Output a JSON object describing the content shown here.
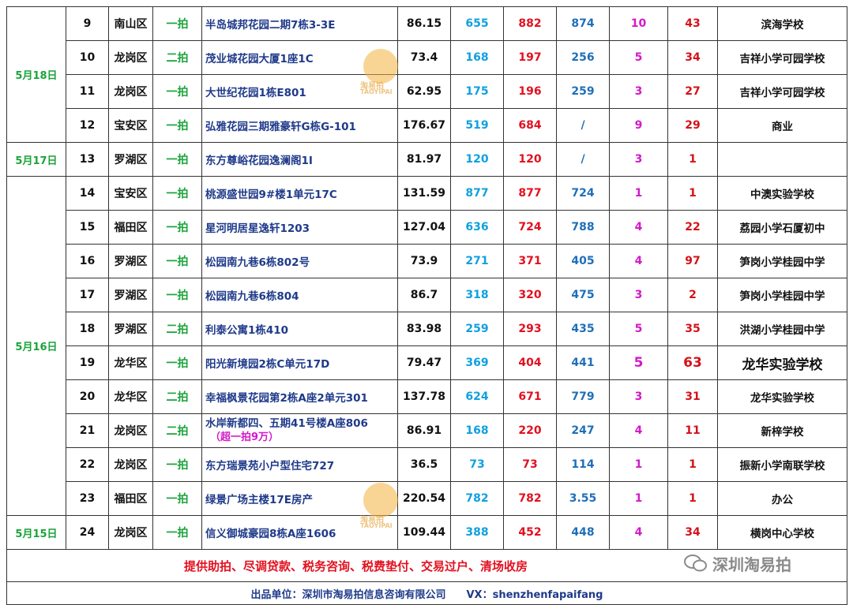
{
  "rows": [
    {
      "date": "",
      "no": "9",
      "district": "南山区",
      "type": "一拍",
      "address": "半岛城邦花园二期7栋3-3E",
      "note": "",
      "area": "86.15",
      "v1": "655",
      "v2": "882",
      "v3": "874",
      "v4": "10",
      "v5": "43",
      "school": "滨海学校"
    },
    {
      "date": "5月18日",
      "no": "10",
      "district": "龙岗区",
      "type": "二拍",
      "address": "茂业城花园大厦1座1C",
      "note": "",
      "area": "73.4",
      "v1": "168",
      "v2": "197",
      "v3": "256",
      "v4": "5",
      "v5": "34",
      "school": "吉祥小学可园学校"
    },
    {
      "date": "",
      "no": "11",
      "district": "龙岗区",
      "type": "一拍",
      "address": "大世纪花园1栋E801",
      "note": "",
      "area": "62.95",
      "v1": "175",
      "v2": "196",
      "v3": "259",
      "v4": "3",
      "v5": "27",
      "school": "吉祥小学可园学校"
    },
    {
      "date": "",
      "no": "12",
      "district": "宝安区",
      "type": "一拍",
      "address": "弘雅花园三期雅豪轩G栋G-101",
      "note": "",
      "area": "176.67",
      "v1": "519",
      "v2": "684",
      "v3": "/",
      "v4": "9",
      "v5": "29",
      "school": "商业"
    },
    {
      "date": "5月17日",
      "no": "13",
      "district": "罗湖区",
      "type": "一拍",
      "address": "东方尊峪花园逸澜阁1I",
      "note": "",
      "area": "81.97",
      "v1": "120",
      "v2": "120",
      "v3": "/",
      "v4": "3",
      "v5": "1",
      "school": ""
    },
    {
      "date": "",
      "no": "14",
      "district": "宝安区",
      "type": "一拍",
      "address": "桃源盛世园9#楼1单元17C",
      "note": "",
      "area": "131.59",
      "v1": "877",
      "v2": "877",
      "v3": "724",
      "v4": "1",
      "v5": "1",
      "school": "中澳实验学校"
    },
    {
      "date": "",
      "no": "15",
      "district": "福田区",
      "type": "一拍",
      "address": "星河明居星逸轩1203",
      "note": "",
      "area": "127.04",
      "v1": "636",
      "v2": "724",
      "v3": "788",
      "v4": "4",
      "v5": "22",
      "school": "荔园小学石厦初中"
    },
    {
      "date": "",
      "no": "16",
      "district": "罗湖区",
      "type": "一拍",
      "address": "松园南九巷6栋802号",
      "note": "",
      "area": "73.9",
      "v1": "271",
      "v2": "371",
      "v3": "405",
      "v4": "4",
      "v5": "97",
      "school": "笋岗小学桂园中学"
    },
    {
      "date": "",
      "no": "17",
      "district": "罗湖区",
      "type": "一拍",
      "address": "松园南九巷6栋804",
      "note": "",
      "area": "86.7",
      "v1": "318",
      "v2": "320",
      "v3": "475",
      "v4": "3",
      "v5": "2",
      "school": "笋岗小学桂园中学"
    },
    {
      "date": "5月16日",
      "no": "18",
      "district": "罗湖区",
      "type": "二拍",
      "address": "利泰公寓1栋410",
      "note": "",
      "area": "83.98",
      "v1": "259",
      "v2": "293",
      "v3": "435",
      "v4": "5",
      "v5": "35",
      "school": "洪湖小学桂园中学"
    },
    {
      "date": "",
      "no": "19",
      "district": "龙华区",
      "type": "一拍",
      "address": "阳光新境园2栋C单元17D",
      "note": "",
      "area": "79.47",
      "v1": "369",
      "v2": "404",
      "v3": "441",
      "v4": "5",
      "v5": "63",
      "school": "龙华实验学校"
    },
    {
      "date": "",
      "no": "20",
      "district": "龙华区",
      "type": "二拍",
      "address": "幸福枫景花园第2栋A座2单元301",
      "note": "",
      "area": "137.78",
      "v1": "624",
      "v2": "671",
      "v3": "779",
      "v4": "3",
      "v5": "31",
      "school": "龙华实验学校"
    },
    {
      "date": "",
      "no": "21",
      "district": "龙岗区",
      "type": "二拍",
      "address": "水岸新都四、五期41号楼A座806",
      "note": "（超一拍9万）",
      "area": "86.91",
      "v1": "168",
      "v2": "220",
      "v3": "247",
      "v4": "4",
      "v5": "11",
      "school": "新梓学校"
    },
    {
      "date": "",
      "no": "22",
      "district": "龙岗区",
      "type": "一拍",
      "address": "东方瑞景苑小户型住宅727",
      "note": "",
      "area": "36.5",
      "v1": "73",
      "v2": "73",
      "v3": "114",
      "v4": "1",
      "v5": "1",
      "school": "振新小学南联学校"
    },
    {
      "date": "",
      "no": "23",
      "district": "福田区",
      "type": "一拍",
      "address": "绿景广场主楼17E房产",
      "note": "",
      "area": "220.54",
      "v1": "782",
      "v2": "782",
      "v3": "3.55",
      "v4": "1",
      "v5": "1",
      "school": "办公"
    },
    {
      "date": "5月15日",
      "no": "24",
      "district": "龙岗区",
      "type": "一拍",
      "address": "信义御城豪园8栋A座1606",
      "note": "",
      "area": "109.44",
      "v1": "388",
      "v2": "452",
      "v3": "448",
      "v4": "4",
      "v5": "34",
      "school": "横岗中心学校"
    }
  ],
  "services": "提供助拍、尽调贷款、税务咨询、税费垫付、交易过户、清场收房",
  "footer": "出品单位：深圳市淘易拍信息咨询有限公司　　VX：shenzhenfapaifang",
  "brand": "深圳淘易拍",
  "watermark": {
    "name": "淘易拍",
    "latin": "TAOYIPAI"
  },
  "colors": {
    "date": "#1aa33a",
    "type": "#1aa33a",
    "address": "#1f3a8a",
    "v1": "#10a0e0",
    "v2": "#e3101f",
    "v3": "#1f6fb8",
    "v4": "#d419c8",
    "v5": "#d41218",
    "services": "#e3101f"
  }
}
